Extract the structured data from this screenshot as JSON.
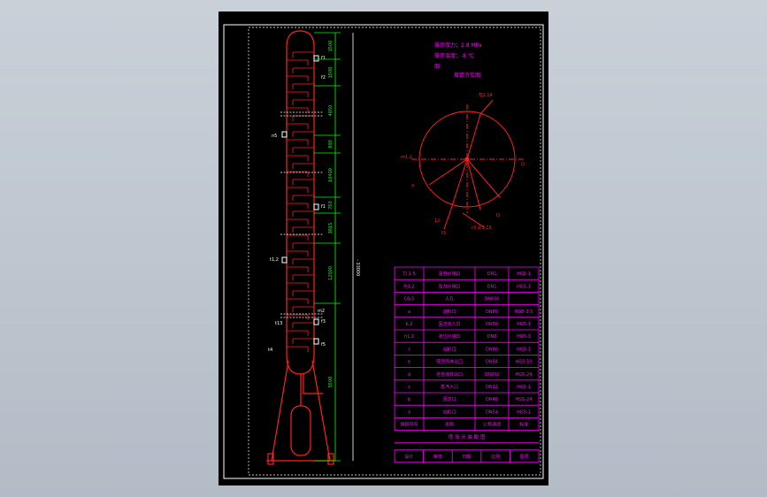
{
  "viewport": {
    "background": "#c0c7cf"
  },
  "colors": {
    "sheet": "#000000",
    "frame": "#ffffff",
    "vessel": "#ff0000",
    "dimension": "#00ff00",
    "text": "#ffffff",
    "table_lines": "#ff00ff",
    "table_text": "#ff00ff"
  },
  "drawing": {
    "notes": [
      "操作压力：2.8 MPa",
      "操作温度：-8 ℃",
      "图"
    ],
    "orientation_label": "接管方位图",
    "height_dims": [
      "1500",
      "1500",
      "4650",
      "800",
      "10400",
      "750",
      "3015",
      "12000",
      "5500"
    ],
    "overall_dim": "- 33000",
    "nozzle_labels": [
      "f1",
      "f2",
      "m",
      "n5",
      "t1,2",
      "f1",
      "m2",
      "f3",
      "t13",
      "f5",
      "z",
      "j1",
      "t4"
    ],
    "orientation": {
      "labels": [
        "TJ1,14",
        "m1,2",
        "Q",
        "a",
        "D",
        "f1,2,4",
        "12",
        "f3",
        "t1,2",
        "r3,d,3,15"
      ]
    }
  },
  "nozzle_table": {
    "rows": [
      {
        "symbol": "TJ 1-5",
        "name": "温度计接口",
        "size": "DN1",
        "std": "HG5-1"
      },
      {
        "symbol": "PJ1,2",
        "name": "压力计接口",
        "size": "DN1",
        "std": "HG5-1"
      },
      {
        "symbol": "C0-5",
        "name": "人孔",
        "size": "DN600",
        "std": ""
      },
      {
        "symbol": "a",
        "name": "进料口",
        "size": "DN80",
        "std": "HG5-3.5"
      },
      {
        "symbol": "b,2",
        "name": "回流液入口",
        "size": "DN50",
        "std": "HG5-1"
      },
      {
        "symbol": "h1,2",
        "name": "液位计接口",
        "size": "DN6",
        "std": "HG5-1"
      },
      {
        "symbol": "i",
        "name": "出料口",
        "size": "DN80",
        "std": "HG5-1"
      },
      {
        "symbol": "e",
        "name": "塔顶气体出口",
        "size": "DN54",
        "std": "HG5-10"
      },
      {
        "symbol": "d",
        "name": "塔釜液体出口",
        "size": "DN300",
        "std": "HG5-24"
      },
      {
        "symbol": "c",
        "name": "蒸汽入口",
        "size": "DN32",
        "std": "HG5-1"
      },
      {
        "symbol": "b",
        "name": "回流口",
        "size": "DN40",
        "std": "HG5-24"
      },
      {
        "symbol": "a",
        "name": "出料口",
        "size": "DN54",
        "std": "HG5-1"
      }
    ],
    "header": {
      "symbol": "接管符号",
      "name": "名称",
      "size": "公称通径",
      "std": "标准"
    },
    "title_row": "塔 设 计 装 配 图",
    "title_block": [
      "设计",
      "审核",
      "日期",
      "比例",
      "图号"
    ]
  }
}
